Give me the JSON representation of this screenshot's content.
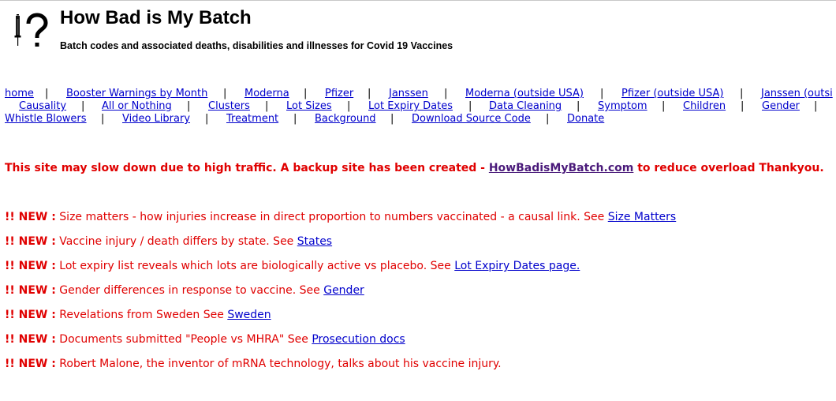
{
  "header": {
    "title": "How Bad is My Batch",
    "subtitle": "Batch codes and associated deaths, disabilities and illnesses for Covid 19 Vaccines",
    "logo_icon": "syringe-question-icon"
  },
  "nav": {
    "row1": [
      "home",
      "Booster Warnings by Month",
      "Moderna",
      "Pfizer",
      "Janssen",
      "Moderna (outside USA)",
      "Pfizer (outside USA)",
      "Janssen (outsi"
    ],
    "row2": [
      "Causality",
      "All or Nothing",
      "Clusters",
      "Lot Sizes",
      "Lot Expiry Dates",
      "Data Cleaning",
      "Symptom",
      "Children",
      "Gender"
    ],
    "row3": [
      "Whistle Blowers",
      "Video Library",
      "Treatment",
      "Background",
      "Download Source Code",
      "Donate"
    ],
    "separator": "|"
  },
  "notice": {
    "text_before": "This site may slow down due to high traffic. A backup site has been created - ",
    "link": "HowBadisMyBatch.com",
    "text_after": " to reduce overload Thankyou."
  },
  "news": {
    "tag": "!! NEW :",
    "items": [
      {
        "text": " Size matters - how injuries increase in direct proportion to numbers vaccinated - a causal link. See ",
        "link": "Size Matters"
      },
      {
        "text": " Vaccine injury / death differs by state. See ",
        "link": "States"
      },
      {
        "text": " Lot expiry list reveals which lots are biologically active vs placebo. See ",
        "link": "Lot Expiry Dates page."
      },
      {
        "text": " Gender differences in response to vaccine. See ",
        "link": "Gender"
      },
      {
        "text": " Revelations from Sweden See ",
        "link": "Sweden"
      },
      {
        "text": " Documents submitted \"People vs MHRA\" See ",
        "link": "Prosecution docs"
      },
      {
        "text": " Robert Malone, the inventor of mRNA technology, talks about his vaccine injury.",
        "link": ""
      }
    ]
  },
  "colors": {
    "link": "#0000cc",
    "alert": "#e00000",
    "visited_link": "#4a1a7a"
  }
}
